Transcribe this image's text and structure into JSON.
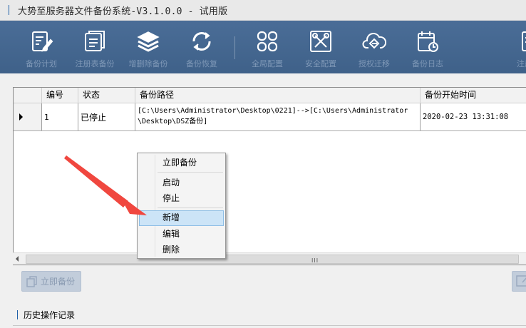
{
  "window": {
    "title": "大势至服务器文件备份系统-V3.1.0.0 - 试用版"
  },
  "toolbar": {
    "buttons": [
      {
        "label": "备份计划",
        "icon": "edit-document-icon"
      },
      {
        "label": "注册表备份",
        "icon": "registry-document-icon"
      },
      {
        "label": "增删除备份",
        "icon": "layers-stack-icon"
      },
      {
        "label": "备份恢复",
        "icon": "sync-refresh-icon"
      },
      {
        "label": "全局配置",
        "icon": "grid-settings-icon"
      },
      {
        "label": "安全配置",
        "icon": "tools-security-icon"
      },
      {
        "label": "授权迁移",
        "icon": "cloud-transfer-icon"
      },
      {
        "label": "备份日志",
        "icon": "calendar-log-icon"
      },
      {
        "label": "注册",
        "icon": "document-icon"
      }
    ]
  },
  "grid": {
    "columns": [
      "编号",
      "状态",
      "备份路径",
      "备份开始时间"
    ],
    "rows": [
      {
        "id": "1",
        "status": "已停止",
        "path_line1": "[C:\\Users\\Administrator\\Desktop\\0221]-->[C:\\Users\\Administrator",
        "path_line2": "\\Desktop\\DSZ备份]",
        "start_time": "2020-02-23 13:31:08"
      }
    ],
    "scroll_grip": "III"
  },
  "context_menu": {
    "items": [
      {
        "label": "立即备份",
        "highlighted": false
      },
      {
        "label": "启动",
        "highlighted": false
      },
      {
        "label": "停止",
        "highlighted": false
      },
      {
        "label": "新增",
        "highlighted": true
      },
      {
        "label": "编辑",
        "highlighted": false
      },
      {
        "label": "删除",
        "highlighted": false
      }
    ]
  },
  "bottom": {
    "backup_now_label": "立即备份"
  },
  "history": {
    "label": "历史操作记录"
  },
  "colors": {
    "toolbar_bg": "#4a6d97",
    "menu_highlight": "#cce4f7",
    "annotation_arrow": "#f0473f"
  }
}
